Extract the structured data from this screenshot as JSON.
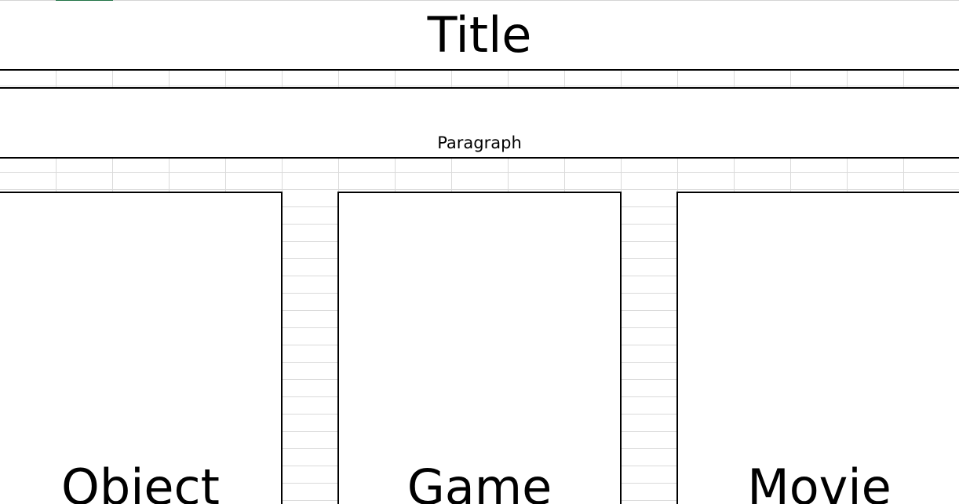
{
  "title": "Title",
  "paragraph": "Paragraph",
  "boxes": [
    {
      "label": "Object"
    },
    {
      "label": "Game"
    },
    {
      "label": "Movie"
    }
  ],
  "colors": {
    "border": "#000000",
    "gridline": "#dadada",
    "selection_accent": "#217346"
  }
}
